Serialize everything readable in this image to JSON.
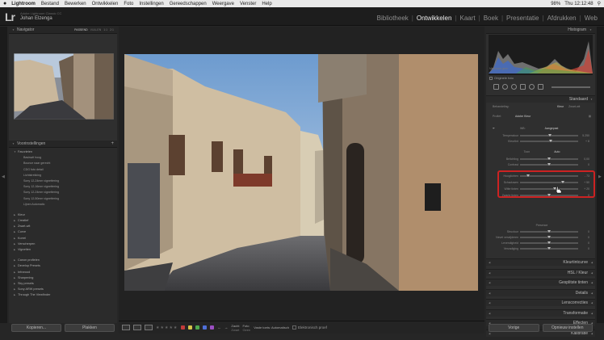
{
  "menubar": {
    "apple": "",
    "items": [
      "Lightroom",
      "Bestand",
      "Bewerken",
      "Ontwikkelen",
      "Foto",
      "Instellingen",
      "Gereedschappen",
      "Weergave",
      "Venster",
      "Help"
    ],
    "battery": "98%",
    "clock": "Thu 12:12:48"
  },
  "identity": {
    "logo": "Lr",
    "small": "Adobe Lightroom Classic CC",
    "name": "Johan Elzenga"
  },
  "modules": [
    "Bibliotheek",
    "Ontwikkelen",
    "Kaart",
    "Boek",
    "Presentatie",
    "Afdrukken",
    "Web"
  ],
  "active_module": "Ontwikkelen",
  "navigator": {
    "title": "Navigator",
    "options": [
      "PASSEND",
      "VULLEN",
      "1:1",
      "2:1"
    ]
  },
  "presets": {
    "title": "Voorinstellingen",
    "add": "+",
    "folders": [
      {
        "label": "Favorieten",
        "open": true,
        "items": [
          "Basiswit hoog",
          "Bounce naar gerecht",
          "CDG foto detail",
          "Lichtstrekking",
          "Sony 12-24mm vignettering",
          "Sony 12-16mm vignettering",
          "Sony 12-24mm vignettering",
          "Sony 12-50mm vignettering",
          "Lijnen Automatic"
        ]
      },
      {
        "label": "Kleur",
        "open": false,
        "items": []
      },
      {
        "label": "Creatief",
        "open": false,
        "items": []
      },
      {
        "label": "Zwart-wit",
        "open": false,
        "items": []
      },
      {
        "label": "Curve",
        "open": false,
        "items": []
      },
      {
        "label": "Korrel",
        "open": false,
        "items": []
      },
      {
        "label": "Verscherpen",
        "open": false,
        "items": []
      },
      {
        "label": "Vignetten",
        "open": false,
        "items": []
      },
      {
        "label": "Canon profielen",
        "open": false,
        "items": []
      },
      {
        "label": "Develop Presets",
        "open": false,
        "items": []
      },
      {
        "label": "Infrarood",
        "open": false,
        "items": []
      },
      {
        "label": "Sharpening",
        "open": false,
        "items": []
      },
      {
        "label": "Sky presets",
        "open": false,
        "items": []
      },
      {
        "label": "Sony ARW presets",
        "open": false,
        "items": []
      },
      {
        "label": "Through The Viewfinder",
        "open": false,
        "items": []
      }
    ]
  },
  "left_buttons": {
    "copy": "Kopieren...",
    "paste": "Plakken"
  },
  "toolbar": {
    "softproof_label": "Zacht",
    "softproof_value": "Zwart",
    "photo_label": "Foto",
    "photo_value": "Geen",
    "fixed_label": "Vaste toets: Automatisch",
    "electronic_proof": "Elektronisch proef"
  },
  "histogram": {
    "title": "Histogram",
    "meta": "Metadata geen",
    "original_photo": "Originele foto"
  },
  "basic": {
    "title": "Standaard",
    "treatment_label": "Behandeling:",
    "treatment_color": "Kleur",
    "treatment_bw": "Zwart-wit",
    "profile_label": "Profiel:",
    "profile_value": "Adobe Kleur",
    "wb_label": "WB:",
    "wb_value": "Aangepast",
    "sliders1": [
      {
        "label": "Temperatuur",
        "value": "5.250",
        "pos": 0.52
      },
      {
        "label": "Kleurtint",
        "value": "+ 8",
        "pos": 0.53
      }
    ],
    "tone_label": "Toon",
    "auto_label": "Auto",
    "sliders2": [
      {
        "label": "Belichting",
        "value": "0,00",
        "pos": 0.5
      },
      {
        "label": "Contrast",
        "value": "0",
        "pos": 0.5
      }
    ],
    "sliders_hl": [
      {
        "label": "Hooglichten",
        "value": "- 73",
        "pos": 0.14
      },
      {
        "label": "Schaduwen",
        "value": "+ 50",
        "pos": 0.74
      },
      {
        "label": "Witte tinten",
        "value": "+ 20",
        "pos": 0.6
      },
      {
        "label": "Zwarte tinten",
        "value": "0",
        "pos": 0.5
      }
    ],
    "presence_label": "Presence",
    "sliders3": [
      {
        "label": "Structuur",
        "value": "0",
        "pos": 0.5
      },
      {
        "label": "Nevel verwijderen",
        "value": "0",
        "pos": 0.5
      },
      {
        "label": "Levendigheid",
        "value": "0",
        "pos": 0.5
      },
      {
        "label": "Verzadiging",
        "value": "0",
        "pos": 0.5
      }
    ]
  },
  "collapsed_sections": [
    "Kleurtintcurve",
    "HSL / Kleur",
    "Gesplitste tinten",
    "Details",
    "Lenscorrecties",
    "Transformatie",
    "Effecten",
    "Kalibratie"
  ],
  "right_buttons": {
    "previous": "Vorige",
    "reset": "Opnieuw instellen"
  },
  "colors": {
    "accent_highlight": "#cc2222",
    "panel": "#2f2f2f",
    "background": "#262626",
    "flags": [
      "#c23b3b",
      "#d6c34a",
      "#4ea84e",
      "#4f6fd8",
      "#9b4fc2"
    ]
  }
}
